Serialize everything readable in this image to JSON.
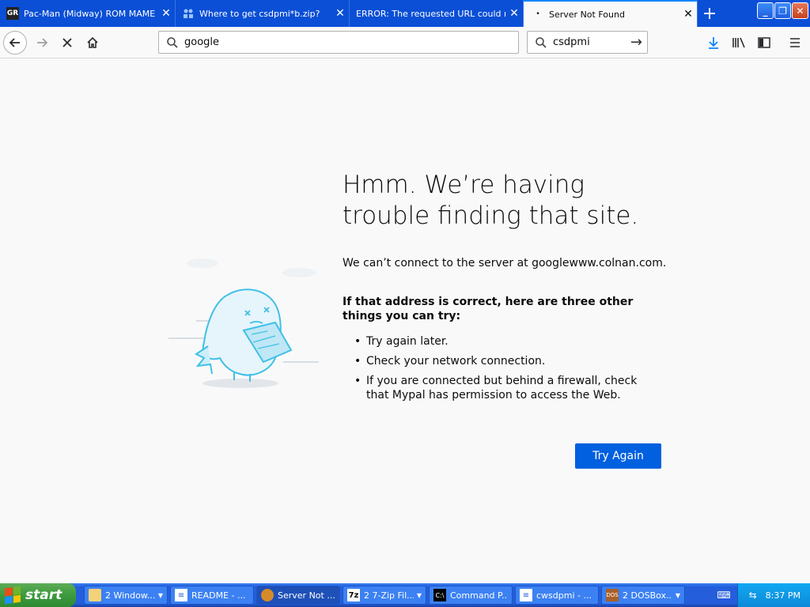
{
  "tabs": [
    {
      "title": "Pac-Man (Midway) ROM MAME - C",
      "favicon": "pacman-icon",
      "active": false
    },
    {
      "title": "Where to get csdpmi*b.zip?",
      "favicon": "people-icon",
      "active": false
    },
    {
      "title": "ERROR: The requested URL could not",
      "favicon": "",
      "active": false
    },
    {
      "title": "Server Not Found",
      "favicon": "dot-icon",
      "active": true
    }
  ],
  "urlbar": {
    "value": "google"
  },
  "searchbar": {
    "value": "csdpmi"
  },
  "error": {
    "title": "Hmm. We’re having trouble finding that site.",
    "description": "We can’t connect to the server at googlewww.colnan.com.",
    "subtitle": "If that address is correct, here are three other things you can try:",
    "items": [
      "Try again later.",
      "Check your network connection.",
      "If you are connected but behind a firewall, check that Mypal has permission to access the Web."
    ],
    "button": "Try Again"
  },
  "taskbar": {
    "start_label": "start",
    "items": [
      {
        "label": "2 Window...",
        "icon": "folder-icon",
        "caret": true
      },
      {
        "label": "README - ...",
        "icon": "notepad-icon",
        "caret": false
      },
      {
        "label": "Server Not ...",
        "icon": "browser-icon",
        "caret": false,
        "active": true
      },
      {
        "label": "2 7-Zip Fil...",
        "icon": "7zip-icon",
        "caret": true
      },
      {
        "label": "Command P...",
        "icon": "cmd-icon",
        "caret": false
      },
      {
        "label": "cwsdpmi - ...",
        "icon": "notepad-icon",
        "caret": false
      },
      {
        "label": "2 DOSBox...",
        "icon": "dosbox-icon",
        "caret": true
      }
    ],
    "clock": "8:37 PM"
  },
  "colors": {
    "accent": "#0060df",
    "tabstrip": "#0a4fd6",
    "start": "#3c9a3e"
  }
}
